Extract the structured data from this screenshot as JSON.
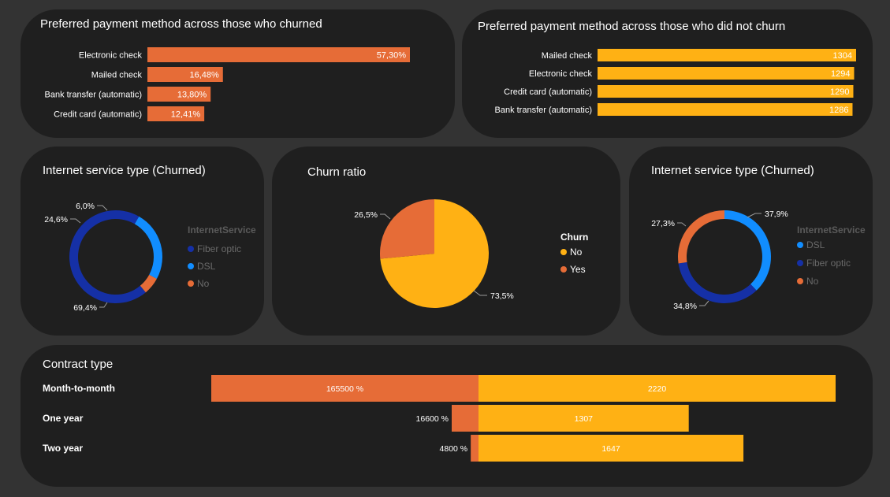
{
  "colors": {
    "orange": "#E66C37",
    "yellow": "#FFB114",
    "dark_blue": "#1530A6",
    "light_blue": "#118DFF",
    "card_bg": "#1f1f1f",
    "page_bg": "#333333"
  },
  "chart_data": [
    {
      "type": "bar",
      "title": "Preferred payment method across those who churned",
      "categories": [
        "Electronic check",
        "Mailed check",
        "Bank transfer (automatic)",
        "Credit card (automatic)"
      ],
      "values": [
        57.3,
        16.48,
        13.8,
        12.41
      ],
      "value_labels": [
        "57,30%",
        "16,48%",
        "13,80%",
        "12,41%"
      ],
      "xlim": [
        0,
        57.3
      ]
    },
    {
      "type": "bar",
      "title": "Preferred payment method across those who did not churn",
      "categories": [
        "Mailed check",
        "Electronic check",
        "Credit card (automatic)",
        "Bank transfer (automatic)"
      ],
      "values": [
        1304,
        1294,
        1290,
        1286
      ],
      "value_labels": [
        "1304",
        "1294",
        "1290",
        "1286"
      ],
      "xlim": [
        0,
        1304
      ]
    },
    {
      "type": "pie",
      "title": "Internet service type (Churned)",
      "legend_title": "InternetService",
      "legend_items": [
        "Fiber optic",
        "DSL",
        "No"
      ],
      "slices": [
        {
          "name": "Fiber optic",
          "value": 69.4,
          "label": "69,4%"
        },
        {
          "name": "DSL",
          "value": 24.6,
          "label": "24,6%"
        },
        {
          "name": "No",
          "value": 6.0,
          "label": "6,0%"
        }
      ]
    },
    {
      "type": "pie",
      "title": "Churn ratio",
      "legend_title": "Churn",
      "legend_items": [
        "No",
        "Yes"
      ],
      "slices": [
        {
          "name": "No",
          "value": 73.5,
          "label": "73,5%"
        },
        {
          "name": "Yes",
          "value": 26.5,
          "label": "26,5%"
        }
      ]
    },
    {
      "type": "pie",
      "title": "Internet service type (Churned)",
      "legend_title": "InternetService",
      "legend_items": [
        "DSL",
        "Fiber optic",
        "No"
      ],
      "slices": [
        {
          "name": "DSL",
          "value": 37.9,
          "label": "37,9%"
        },
        {
          "name": "Fiber optic",
          "value": 34.8,
          "label": "34,8%"
        },
        {
          "name": "No",
          "value": 27.3,
          "label": "27,3%"
        }
      ]
    },
    {
      "type": "bar",
      "title": "Contract type",
      "categories": [
        "Month-to-month",
        "One year",
        "Two year"
      ],
      "series": [
        {
          "values": [
            1655,
            166,
            48
          ],
          "value_labels": [
            "165500 %",
            "16600 %",
            "4800 %"
          ]
        },
        {
          "values": [
            2220,
            1307,
            1647
          ],
          "value_labels": [
            "2220",
            "1307",
            "1647"
          ]
        }
      ]
    }
  ]
}
